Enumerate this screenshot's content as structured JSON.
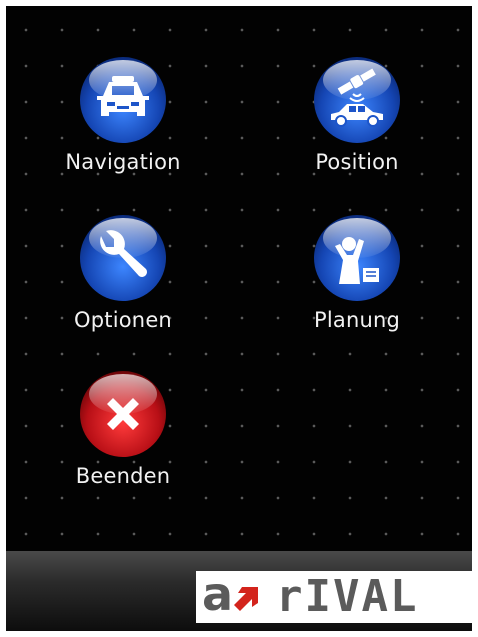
{
  "menu": {
    "items": [
      {
        "label": "Navigation",
        "icon": "car-icon"
      },
      {
        "label": "Position",
        "icon": "satellite-car-icon"
      },
      {
        "label": "Optionen",
        "icon": "wrench-icon"
      },
      {
        "label": "Planung",
        "icon": "planning-icon"
      },
      {
        "label": "Beenden",
        "icon": "close-icon"
      }
    ]
  },
  "brand": {
    "logo_letter": "a",
    "logo_text": "rIVAL"
  },
  "colors": {
    "orb_blue": "#1f5fc9",
    "orb_red": "#c0121a",
    "logo_gray": "#5b5b5b",
    "logo_arrow": "#d3241c"
  }
}
